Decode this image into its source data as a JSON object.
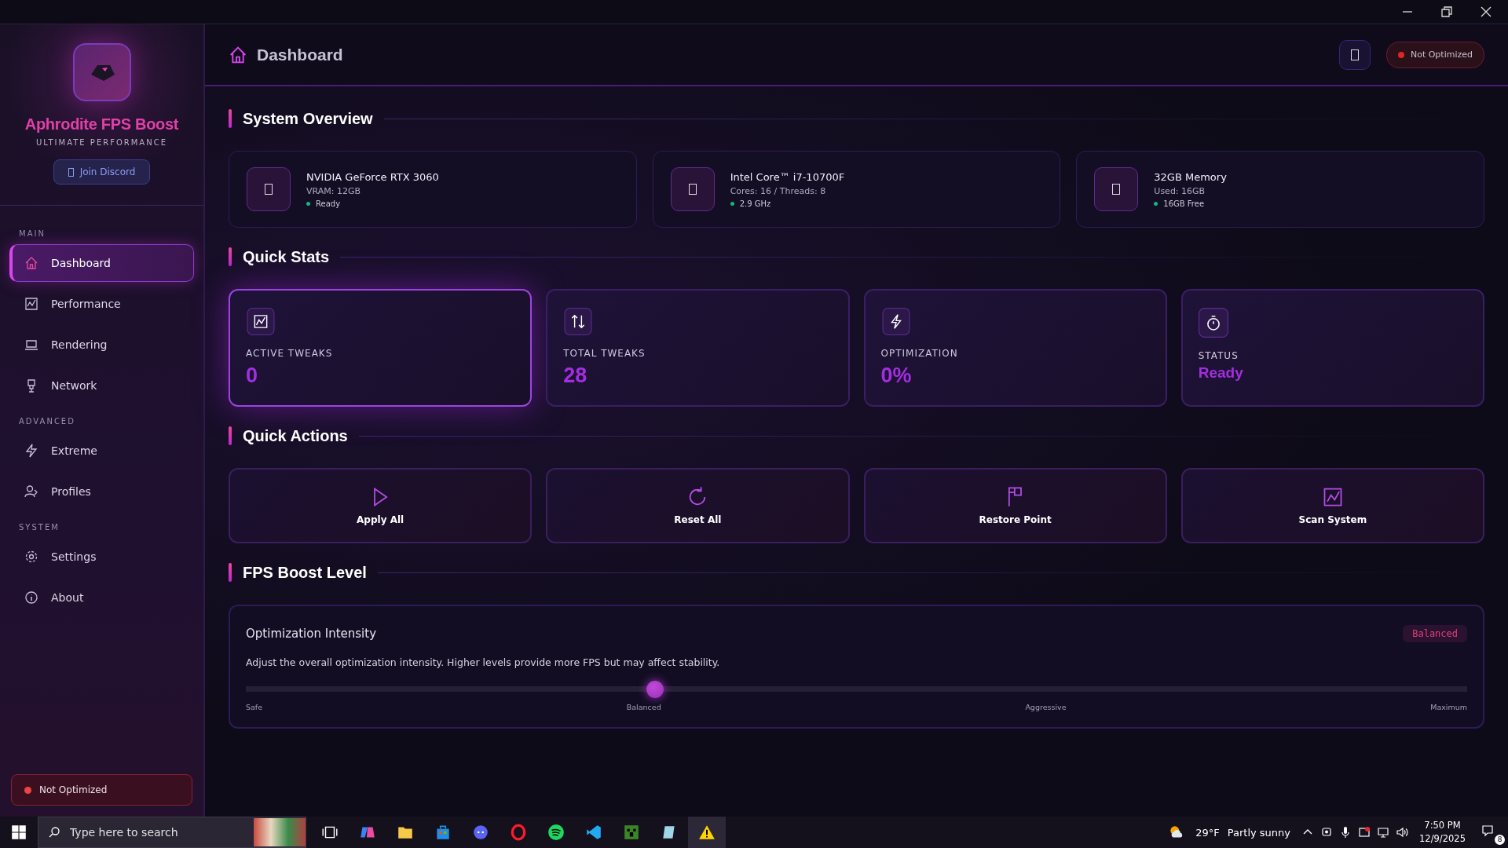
{
  "sidebar": {
    "app_name": "Aphrodite FPS Boost",
    "tagline": "ULTIMATE PERFORMANCE",
    "discord_button": "Join Discord",
    "sections": [
      {
        "heading": "MAIN",
        "items": [
          {
            "label": "Dashboard",
            "selected": true
          },
          {
            "label": "Performance",
            "selected": false
          },
          {
            "label": "Rendering",
            "selected": false
          },
          {
            "label": "Network",
            "selected": false
          }
        ]
      },
      {
        "heading": "ADVANCED",
        "items": [
          {
            "label": "Extreme",
            "selected": false
          },
          {
            "label": "Profiles",
            "selected": false
          }
        ]
      },
      {
        "heading": "SYSTEM",
        "items": [
          {
            "label": "Settings",
            "selected": false
          },
          {
            "label": "About",
            "selected": false
          }
        ]
      }
    ],
    "status": {
      "label": "Not Optimized",
      "color": "#ef4444"
    }
  },
  "header": {
    "title": "Dashboard",
    "status": {
      "label": "Not Optimized",
      "color": "#dc2626"
    }
  },
  "system_overview": {
    "title": "System Overview",
    "cards": [
      {
        "name": "NVIDIA GeForce RTX 3060",
        "detail": "VRAM: 12GB",
        "status": "Ready",
        "color": "#10b981"
      },
      {
        "name": "Intel Core™ i7-10700F",
        "detail": "Cores: 16 / Threads: 8",
        "status": "2.9 GHz",
        "color": "#10b981"
      },
      {
        "name": "32GB Memory",
        "detail": "Used: 16GB",
        "status": "16GB Free",
        "color": "#10b981"
      }
    ]
  },
  "quick_stats": {
    "title": "Quick Stats",
    "cards": [
      {
        "label": "ACTIVE TWEAKS",
        "value": "0",
        "selected": true
      },
      {
        "label": "TOTAL TWEAKS",
        "value": "28",
        "selected": false
      },
      {
        "label": "OPTIMIZATION",
        "value": "0%",
        "selected": false
      },
      {
        "label": "STATUS",
        "value": "Ready",
        "selected": false
      }
    ]
  },
  "quick_actions": {
    "title": "Quick Actions",
    "buttons": [
      "Apply All",
      "Reset All",
      "Restore Point",
      "Scan System"
    ]
  },
  "fps_boost": {
    "title": "FPS Boost Level",
    "heading": "Optimization Intensity",
    "badge": "Balanced",
    "description": "Adjust the overall optimization intensity. Higher levels provide more FPS but may affect stability.",
    "slider": {
      "level": 0.335
    },
    "marks": [
      "Safe",
      "Balanced",
      "Aggressive",
      "Maximum"
    ]
  },
  "taskbar": {
    "search_placeholder": "Type here to search",
    "temperature": "29°F",
    "weather": "Partly sunny",
    "time": "7:50 PM",
    "date": "12/9/2025",
    "notifications": "8"
  }
}
